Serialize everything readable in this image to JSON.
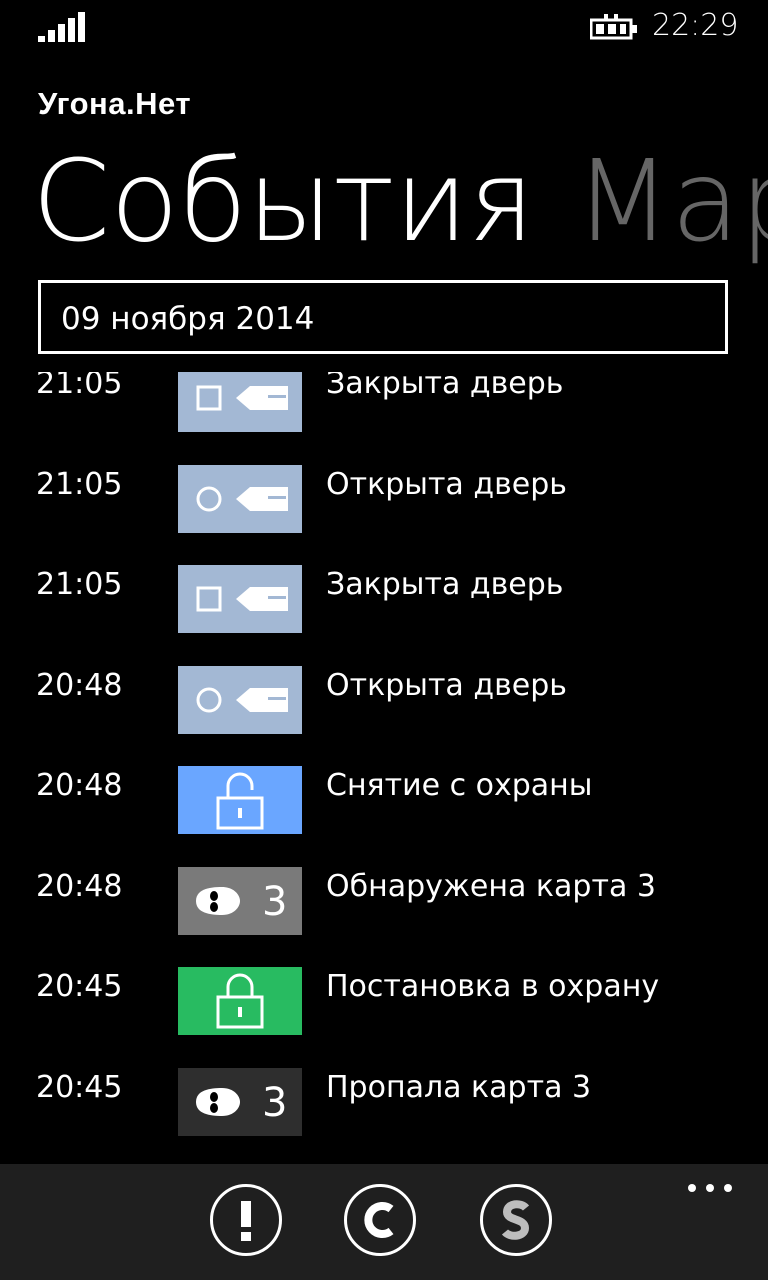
{
  "status_bar": {
    "time": "22:29",
    "signal_icon": "signal-strength-icon",
    "battery_icon": "battery-charging-icon"
  },
  "app": {
    "title": "Угона.Нет"
  },
  "pivot": {
    "active": "События",
    "next": "Марш"
  },
  "date_picker": {
    "value": "09 ноября 2014"
  },
  "events": [
    {
      "time": "21:05",
      "label": "Закрыта дверь",
      "icon": "door-closed-icon",
      "tile_color": "#a3b8d4"
    },
    {
      "time": "21:05",
      "label": "Открыта дверь",
      "icon": "door-open-icon",
      "tile_color": "#a3b8d4"
    },
    {
      "time": "21:05",
      "label": "Закрыта дверь",
      "icon": "door-closed-icon",
      "tile_color": "#a3b8d4"
    },
    {
      "time": "20:48",
      "label": "Открыта дверь",
      "icon": "door-open-icon",
      "tile_color": "#a3b8d4"
    },
    {
      "time": "20:48",
      "label": "Снятие с охраны",
      "icon": "unlock-icon",
      "tile_color": "#6aa6ff"
    },
    {
      "time": "20:48",
      "label": "Обнаружена карта 3",
      "icon": "card-detected-icon",
      "tile_color": "#7a7a7a",
      "badge": "3"
    },
    {
      "time": "20:45",
      "label": "Постановка в охрану",
      "icon": "lock-icon",
      "tile_color": "#28bb61"
    },
    {
      "time": "20:45",
      "label": "Пропала карта 3",
      "icon": "card-lost-icon",
      "tile_color": "#2e2e2e",
      "badge": "3"
    },
    {
      "time": "",
      "label": "",
      "icon": "door-closed-icon",
      "tile_color": "#a3b8d4"
    }
  ],
  "app_bar": {
    "buttons": [
      {
        "icon": "alert-icon",
        "glyph": "!"
      },
      {
        "icon": "c-icon",
        "glyph": "C"
      },
      {
        "icon": "s-icon",
        "glyph": "S"
      }
    ],
    "more_icon": "ellipsis-icon"
  },
  "colors": {
    "background": "#000000",
    "app_bar": "#1f1f1f",
    "pivot_inactive": "#666666"
  }
}
